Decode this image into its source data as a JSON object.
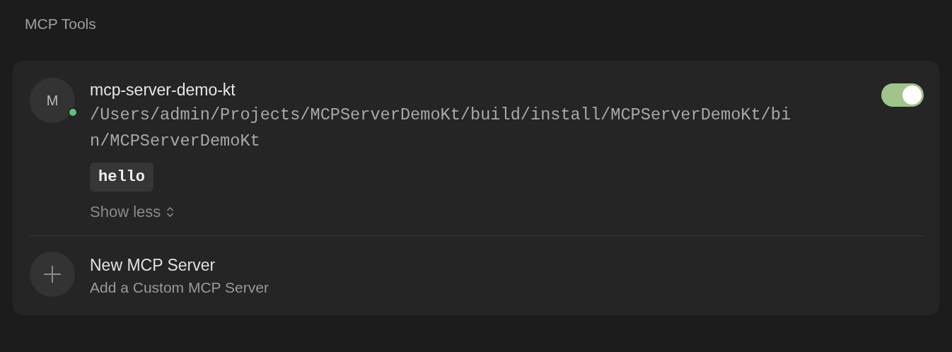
{
  "section_title": "MCP Tools",
  "servers": [
    {
      "avatar": "M",
      "name": "mcp-server-demo-kt",
      "path": "/Users/admin/Projects/MCPServerDemoKt/build/install/MCPServerDemoKt/bin/MCPServerDemoKt",
      "online": true,
      "enabled": true,
      "tools": [
        "hello"
      ],
      "expand_toggle": "Show less"
    }
  ],
  "new_server": {
    "title": "New MCP Server",
    "subtitle": "Add a Custom MCP Server"
  }
}
